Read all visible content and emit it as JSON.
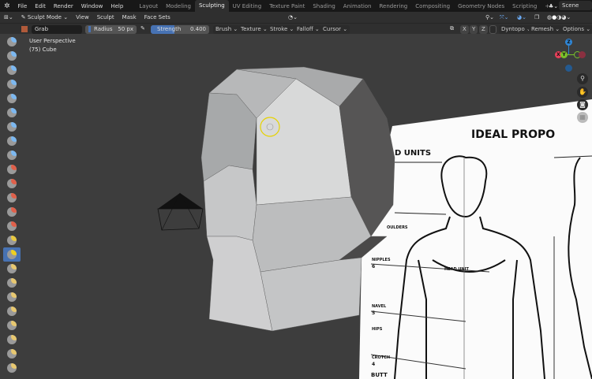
{
  "menu": {
    "items": [
      "File",
      "Edit",
      "Render",
      "Window",
      "Help"
    ],
    "workspaces": [
      "Layout",
      "Modeling",
      "Sculpting",
      "UV Editing",
      "Texture Paint",
      "Shading",
      "Animation",
      "Rendering",
      "Compositing",
      "Geometry Nodes",
      "Scripting"
    ],
    "active_workspace": "Sculpting",
    "add": "+",
    "scene": "Scene"
  },
  "header": {
    "mode": "Sculpt Mode",
    "items": [
      "View",
      "Sculpt",
      "Mask",
      "Face Sets"
    ]
  },
  "tool_settings": {
    "brush": "Grab",
    "radius_label": "Radius",
    "radius_value": "50 px",
    "strength_label": "Strength",
    "strength_value": "0.400",
    "strength_fraction": 0.4,
    "menus": [
      "Brush",
      "Texture",
      "Stroke",
      "Falloff",
      "Cursor"
    ],
    "axes": [
      "X",
      "Y",
      "Z"
    ],
    "dyntopo": "Dyntopo",
    "remesh": "Remesh",
    "options": "Options"
  },
  "viewport": {
    "perspective": "User Perspective",
    "object": "(75) Cube"
  },
  "gizmo": {
    "z": "Z",
    "x": "X",
    "y": "Y"
  },
  "reference": {
    "title": "IDEAL PROPO",
    "units": "D UNITS",
    "labels": [
      "OULDERS",
      "NIPPLES",
      "6",
      "HEAD UNIT",
      "NAVEL",
      "5",
      "HIPS",
      "CROTCH",
      "4",
      "BUTT"
    ]
  },
  "colors": {
    "accent": "#4772b3",
    "brush_cursor": "#e6d200",
    "x": "#e8405a",
    "y": "#7ac02a",
    "z": "#2f86d6"
  },
  "toolbar": {
    "active_index": 15,
    "icons": [
      [
        "draw-brush",
        "#7cb8f0"
      ],
      [
        "draw-sharp-brush",
        "#7cb8f0"
      ],
      [
        "clay-brush",
        "#7cb8f0"
      ],
      [
        "clay-strips-brush",
        "#7cb8f0"
      ],
      [
        "clay-thumb-brush",
        "#7cb8f0"
      ],
      [
        "layer-brush",
        "#7cb8f0"
      ],
      [
        "inflate-brush",
        "#7cb8f0"
      ],
      [
        "blob-brush",
        "#7cb8f0"
      ],
      [
        "crease-brush",
        "#7cb8f0"
      ],
      [
        "smooth-brush",
        "#e0604a"
      ],
      [
        "flatten-brush",
        "#e0604a"
      ],
      [
        "fill-brush",
        "#e0604a"
      ],
      [
        "scrape-brush",
        "#e0604a"
      ],
      [
        "multiplane-scrape-brush",
        "#e0604a"
      ],
      [
        "pinch-brush",
        "#e8c840"
      ],
      [
        "grab-brush",
        "#f0d020"
      ],
      [
        "elastic-deform-brush",
        "#e8c870"
      ],
      [
        "snake-hook-brush",
        "#e8c870"
      ],
      [
        "thumb-brush",
        "#e8c870"
      ],
      [
        "pose-brush",
        "#e8c870"
      ],
      [
        "nudge-brush",
        "#e8c870"
      ],
      [
        "rotate-brush",
        "#e8c870"
      ],
      [
        "slide-relax-brush",
        "#e8c870"
      ],
      [
        "boundary-brush",
        "#e8c870"
      ]
    ]
  }
}
